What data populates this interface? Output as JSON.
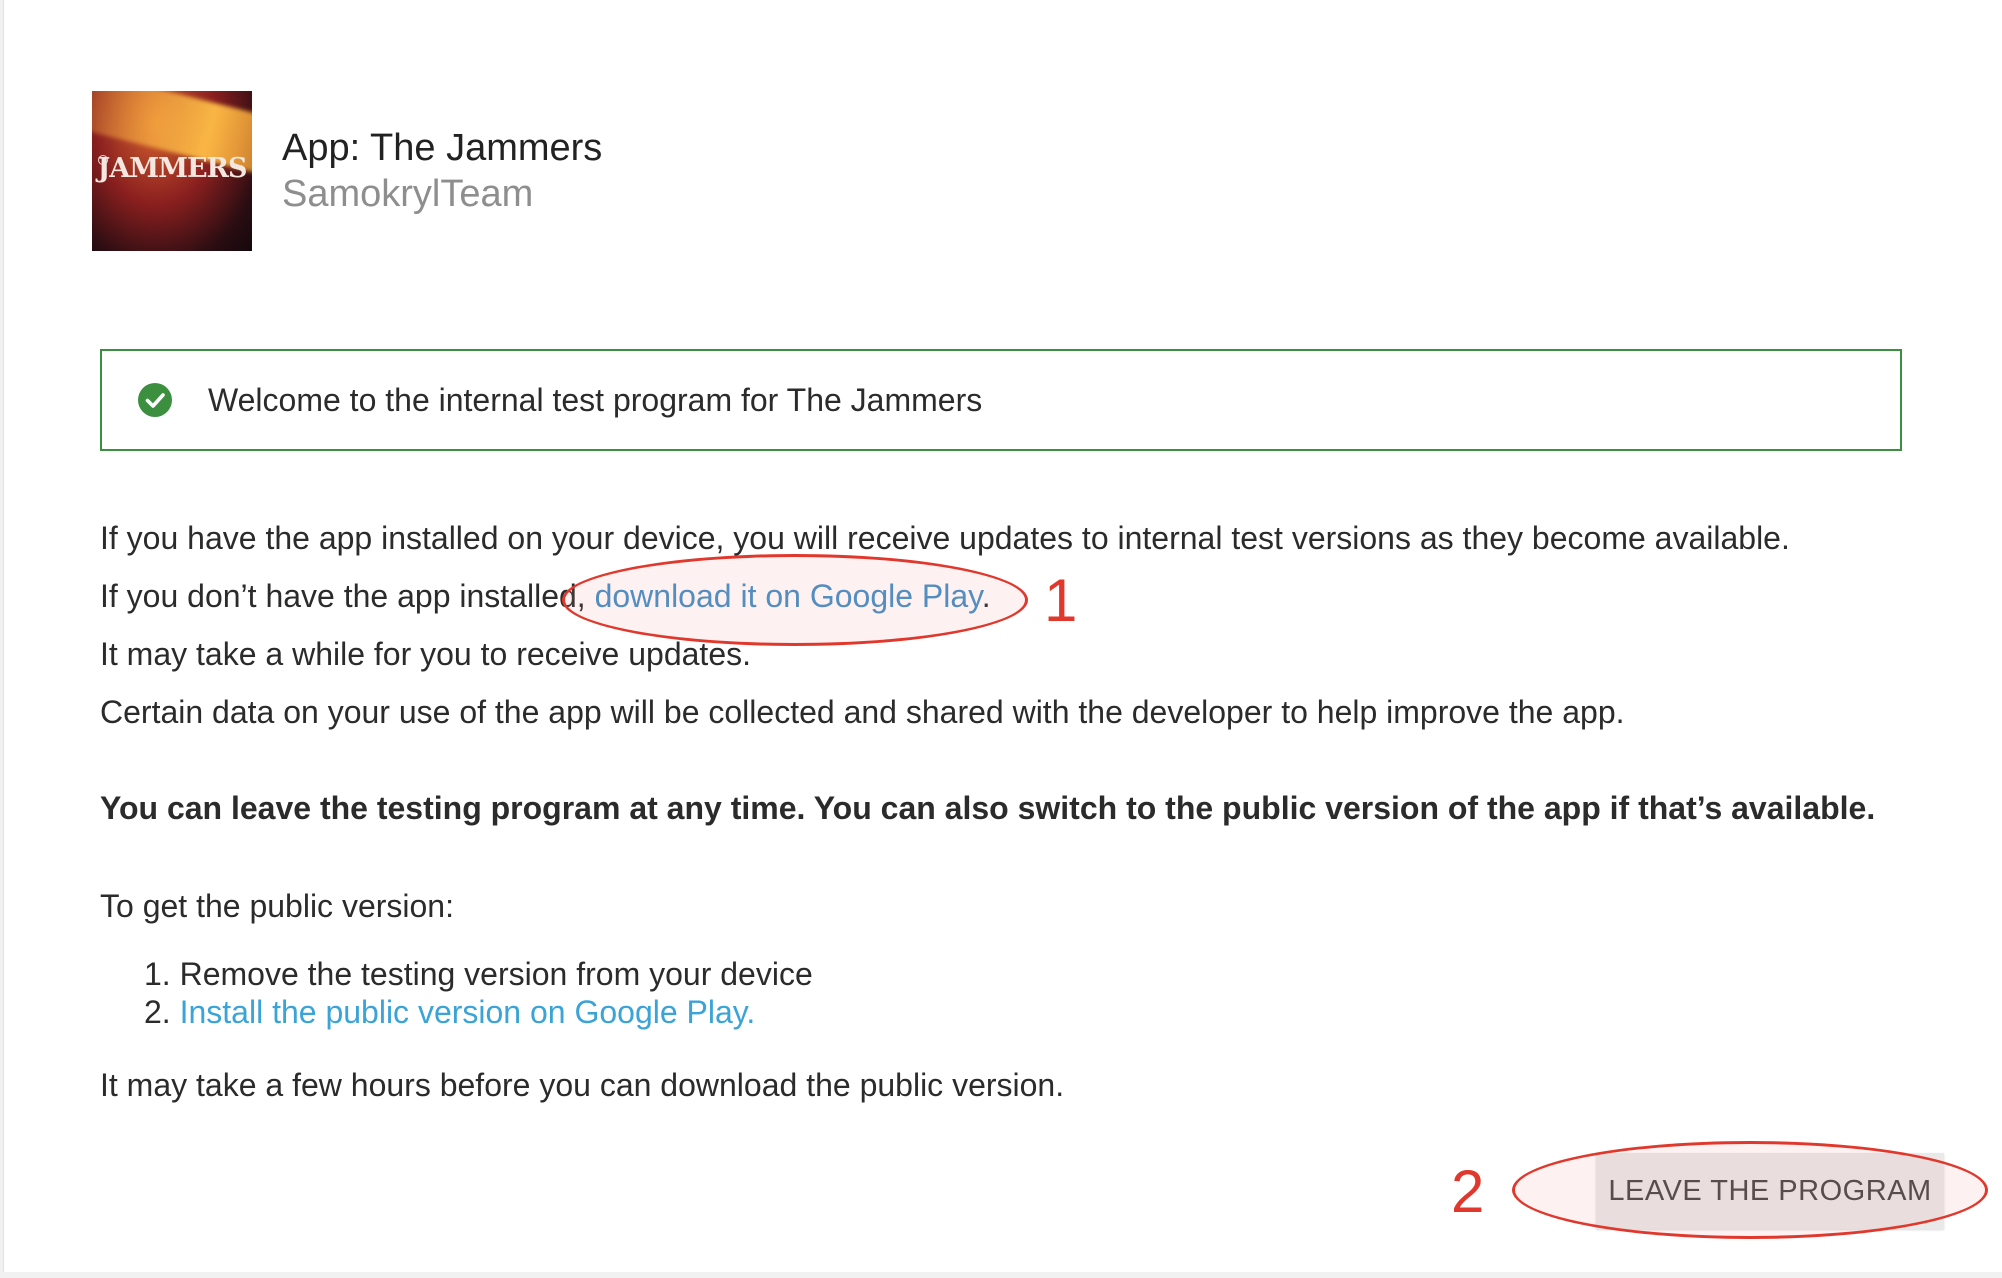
{
  "app": {
    "title": "App: The Jammers",
    "developer": "SamokrylTeam",
    "icon_label": "JAMMERS"
  },
  "welcome": {
    "message": "Welcome to the internal test program for The Jammers",
    "icon": "check-circle-icon",
    "border_color": "#3c8f3f"
  },
  "info": {
    "line1": "If you have the app installed on your device, you will receive updates to internal test versions as they become available.",
    "line2_prefix": "If you don’t have the app installed, ",
    "line2_link": "download it on Google Play",
    "line2_suffix": ".",
    "line3": "It may take a while for you to receive updates.",
    "line4": "Certain data on your use of the app will be collected and shared with the developer to help improve the app."
  },
  "leave_notice": "You can leave the testing program at any time. You can also switch to the public version of the app if that’s available.",
  "public_version": {
    "heading": "To get the public version:",
    "step1_number": "1.",
    "step1": "Remove the testing version from your device",
    "step2_number": "2.",
    "step2_link": "Install the public version on Google Play.",
    "footer": "It may take a few hours before you can download the public version."
  },
  "actions": {
    "leave_label": "LEAVE THE PROGRAM"
  },
  "annotations": {
    "marker1": "1",
    "marker2": "2",
    "color": "#e0382c"
  }
}
